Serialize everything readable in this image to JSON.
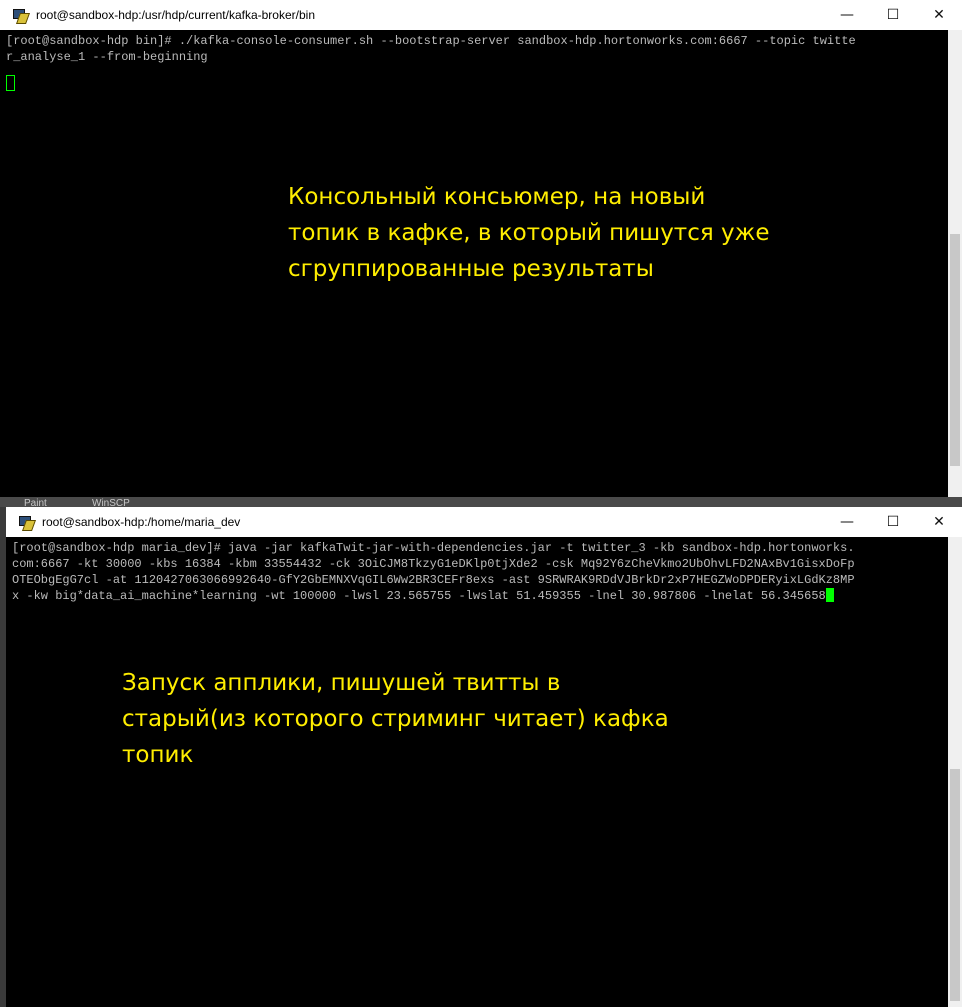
{
  "window1": {
    "title": "root@sandbox-hdp:/usr/hdp/current/kafka-broker/bin",
    "controls": {
      "minimize": "—",
      "maximize": "☐",
      "close": "✕"
    },
    "terminal_lines": [
      "[root@sandbox-hdp bin]# ./kafka-console-consumer.sh --bootstrap-server sandbox-hdp.hortonworks.com:6667 --topic twitte",
      "r_analyse_1 --from-beginning"
    ],
    "annotation": [
      "Консольный консьюмер, на новый",
      "топик в кафке, в который пишутся уже",
      "сгруппированные результаты"
    ]
  },
  "taskbar_fragments": [
    "Paint",
    "WinSCP"
  ],
  "window2": {
    "title": "root@sandbox-hdp:/home/maria_dev",
    "controls": {
      "minimize": "—",
      "maximize": "☐",
      "close": "✕"
    },
    "terminal_lines": [
      "[root@sandbox-hdp maria_dev]# java -jar kafkaTwit-jar-with-dependencies.jar -t twitter_3 -kb sandbox-hdp.hortonworks.",
      "com:6667 -kt 30000 -kbs 16384 -kbm 33554432 -ck 3OiCJM8TkzyG1eDKlp0tjXde2 -csk Mq92Y6zCheVkmo2UbOhvLFD2NAxBv1GisxDoFp",
      "OTEObgEgG7cl -at 1120427063066992640-GfY2GbEMNXVqGIL6Ww2BR3CEFr8exs -ast 9SRWRAK9RDdVJBrkDr2xP7HEGZWoDPDERyixLGdKz8MP",
      "x -kw big*data_ai_machine*learning -wt 100000 -lwsl 23.565755 -lwslat 51.459355 -lnel 30.987806 -lnelat 56.345658"
    ],
    "annotation": [
      "Запуск апплики, пишушей твитты в",
      "старый(из которого стриминг читает) кафка",
      "топик"
    ]
  },
  "colors": {
    "terminal_bg": "#000000",
    "terminal_text": "#bbbbbb",
    "cursor": "#00ff00",
    "annotation": "#ffee00",
    "titlebar": "#ffffff"
  }
}
